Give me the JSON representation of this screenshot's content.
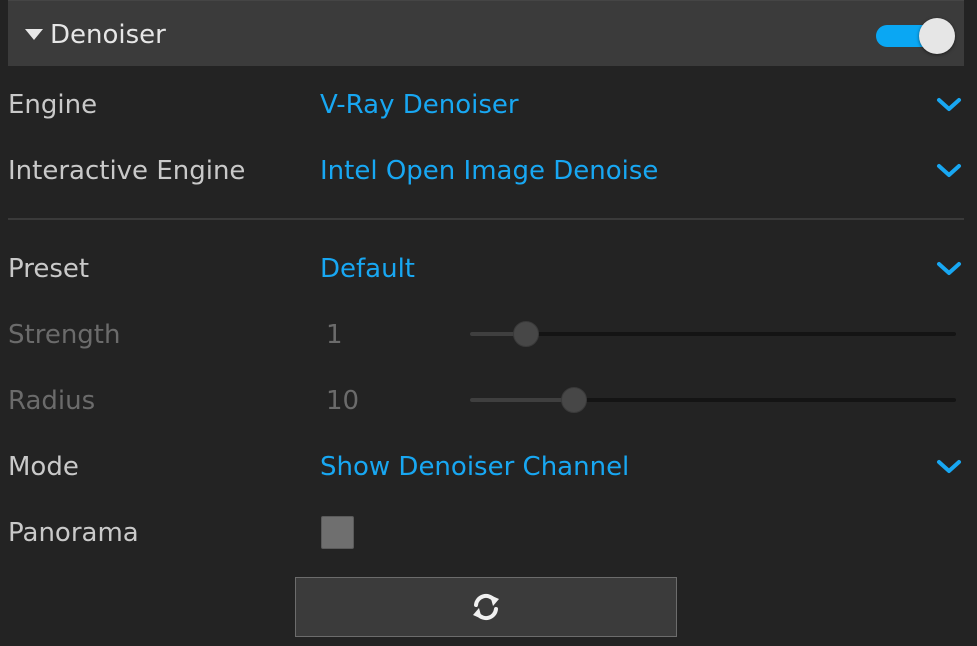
{
  "section": {
    "title": "Denoiser",
    "enabled": true,
    "accent_color": "#0aa7f3"
  },
  "rows": {
    "engine": {
      "label": "Engine",
      "value": "V-Ray Denoiser"
    },
    "interactive_engine": {
      "label": "Interactive Engine",
      "value": "Intel Open Image Denoise"
    },
    "preset": {
      "label": "Preset",
      "value": "Default"
    },
    "strength": {
      "label": "Strength",
      "value": "1",
      "slider_fraction": 0.115
    },
    "radius": {
      "label": "Radius",
      "value": "10",
      "slider_fraction": 0.215
    },
    "mode": {
      "label": "Mode",
      "value": "Show Denoiser Channel"
    },
    "panorama": {
      "label": "Panorama",
      "checked": false
    }
  },
  "icons": {
    "collapse": "triangle-down-icon",
    "dropdown": "chevron-down-icon",
    "refresh": "refresh-icon"
  },
  "colors": {
    "dropdown_text": "#18a7f2",
    "disabled_text": "#6b6b6b"
  }
}
